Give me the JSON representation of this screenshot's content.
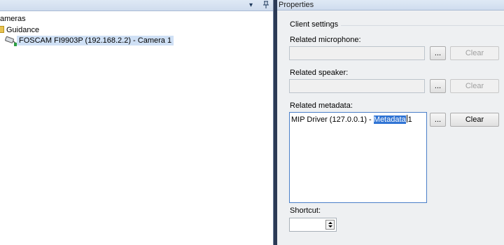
{
  "left_pane": {
    "header": {
      "dropdown_glyph": "▾",
      "pin_glyph": "ᵖ"
    },
    "tree": {
      "root_label": "ameras",
      "guidance_label": "Guidance",
      "camera_label": "FOSCAM FI9903P (192.168.2.2) - Camera 1"
    }
  },
  "right_pane": {
    "title": "Properties",
    "client_settings": {
      "legend": "Client settings",
      "related_microphone": {
        "label": "Related microphone:",
        "value": "",
        "browse_label": "...",
        "clear_label": "Clear",
        "clear_enabled": false
      },
      "related_speaker": {
        "label": "Related speaker:",
        "value": "",
        "browse_label": "...",
        "clear_label": "Clear",
        "clear_enabled": false
      },
      "related_metadata": {
        "label": "Related metadata:",
        "value_prefix": "MIP Driver (127.0.0.1) - ",
        "value_selected": "Metadata",
        "value_suffix": "1",
        "browse_label": "...",
        "clear_label": "Clear",
        "clear_enabled": true
      },
      "shortcut": {
        "label": "Shortcut:",
        "value": ""
      }
    }
  },
  "colors": {
    "splitter": "#2b3a55",
    "selection": "#3074d4",
    "tree_selection": "#cfe0f5"
  }
}
